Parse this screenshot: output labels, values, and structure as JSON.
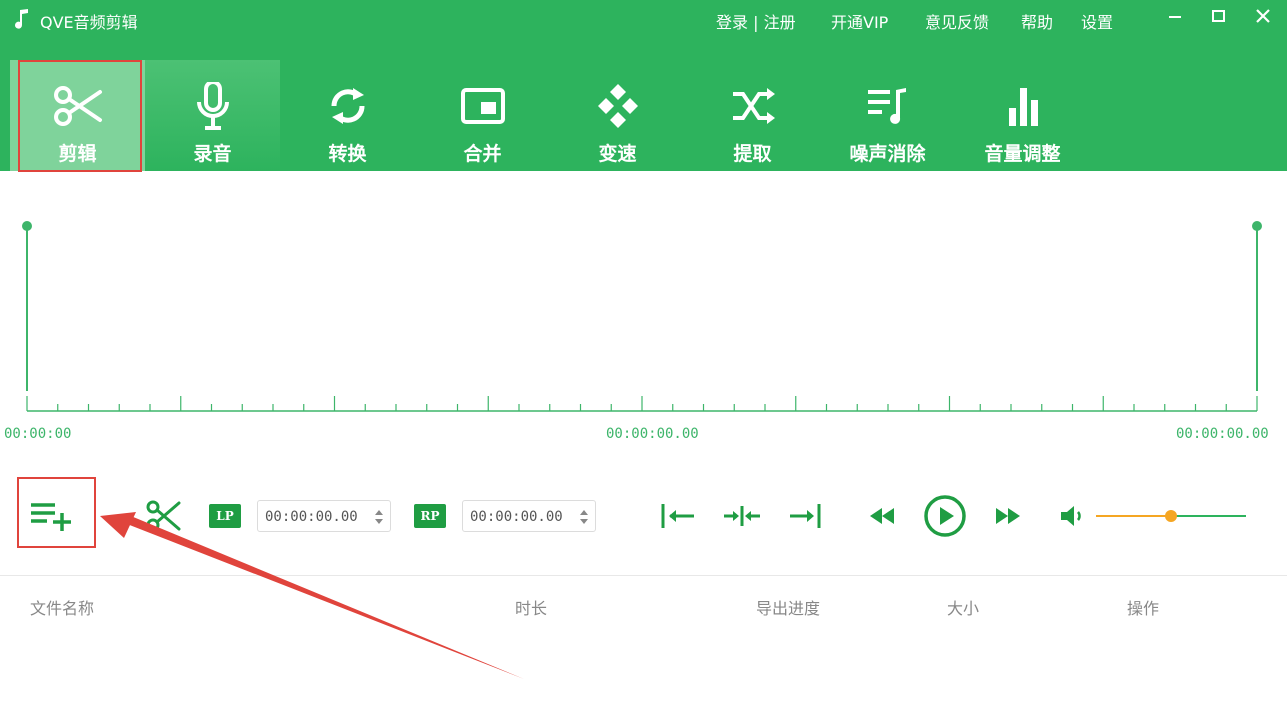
{
  "app": {
    "title": "QVE音频剪辑"
  },
  "header_links": {
    "login_register": "登录 | 注册",
    "vip": "开通VIP",
    "feedback": "意见反馈",
    "help": "帮助",
    "settings": "设置"
  },
  "tabs": [
    {
      "label": "剪辑",
      "icon": "scissors-icon"
    },
    {
      "label": "录音",
      "icon": "microphone-icon"
    },
    {
      "label": "转换",
      "icon": "convert-icon"
    },
    {
      "label": "合并",
      "icon": "merge-icon"
    },
    {
      "label": "变速",
      "icon": "speed-icon"
    },
    {
      "label": "提取",
      "icon": "extract-icon"
    },
    {
      "label": "噪声消除",
      "icon": "noise-removal-icon"
    },
    {
      "label": "音量调整",
      "icon": "volume-adjust-icon"
    }
  ],
  "timeline": {
    "start": "00:00:00",
    "middle": "00:00:00.00",
    "end": "00:00:00.00"
  },
  "controls": {
    "lp_label": "LP",
    "rp_label": "RP",
    "lp_time": "00:00:00.00",
    "rp_time": "00:00:00.00",
    "volume_level": 0.5
  },
  "file_table": {
    "columns": [
      "文件名称",
      "时长",
      "导出进度",
      "大小",
      "操作"
    ]
  },
  "colors": {
    "brand_green": "#2db35d",
    "dark_green": "#1f9d43",
    "highlight": "#e0443c",
    "volume_orange": "#f5a623"
  }
}
